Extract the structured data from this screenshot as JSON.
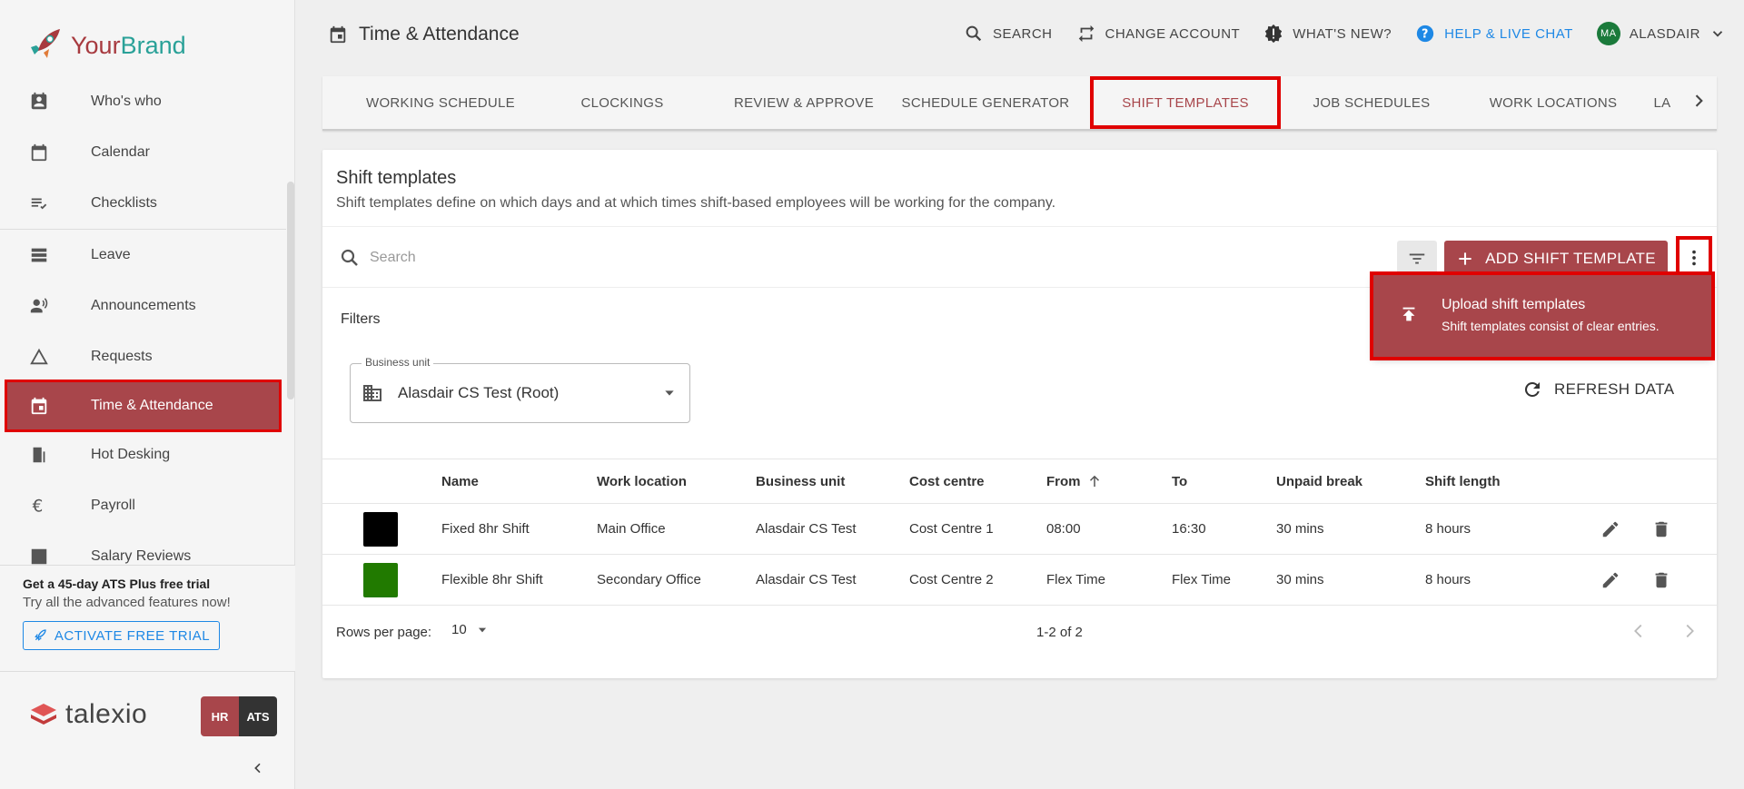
{
  "brand": {
    "part1": "Your",
    "part2": "Brand"
  },
  "sidebar": {
    "items": [
      {
        "label": "Who's who"
      },
      {
        "label": "Calendar"
      },
      {
        "label": "Checklists"
      },
      {
        "label": "Leave"
      },
      {
        "label": "Announcements"
      },
      {
        "label": "Requests"
      },
      {
        "label": "Time & Attendance"
      },
      {
        "label": "Hot Desking"
      },
      {
        "label": "Payroll"
      },
      {
        "label": "Salary Reviews"
      }
    ]
  },
  "trial": {
    "title": "Get a 45-day ATS Plus free trial",
    "subtitle": "Try all the advanced features now!",
    "button": "ACTIVATE FREE TRIAL"
  },
  "footer_brand": {
    "name": "talexio",
    "hr": "HR",
    "ats": "ATS"
  },
  "header": {
    "title": "Time & Attendance",
    "search": "SEARCH",
    "change_account": "CHANGE ACCOUNT",
    "whats_new": "WHAT'S NEW?",
    "help": "HELP & LIVE CHAT",
    "avatar_initials": "MA",
    "user": "ALASDAIR"
  },
  "tabs": [
    {
      "label": "WORKING SCHEDULE"
    },
    {
      "label": "CLOCKINGS"
    },
    {
      "label": "REVIEW & APPROVE"
    },
    {
      "label": "SCHEDULE GENERATOR"
    },
    {
      "label": "SHIFT TEMPLATES",
      "active": true
    },
    {
      "label": "JOB SCHEDULES"
    },
    {
      "label": "WORK LOCATIONS"
    },
    {
      "label": "LA"
    }
  ],
  "card": {
    "title": "Shift templates",
    "description": "Shift templates define on which days and at which times shift-based employees will be working for the company.",
    "search_placeholder": "Search",
    "add_button": "ADD SHIFT TEMPLATE",
    "filters_label": "Filters",
    "business_unit_label": "Business unit",
    "business_unit_value": "Alasdair CS Test (Root)",
    "refresh": "REFRESH DATA"
  },
  "menu": {
    "title": "Upload shift templates",
    "subtitle": "Shift templates consist of clear entries."
  },
  "table": {
    "columns": [
      "Name",
      "Work location",
      "Business unit",
      "Cost centre",
      "From",
      "To",
      "Unpaid break",
      "Shift length"
    ],
    "rows": [
      {
        "color": "#000000",
        "name": "Fixed 8hr Shift",
        "location": "Main Office",
        "unit": "Alasdair CS Test",
        "cost": "Cost Centre 1",
        "from": "08:00",
        "to": "16:30",
        "break": "30 mins",
        "length": "8 hours"
      },
      {
        "color": "#217a00",
        "name": "Flexible 8hr Shift",
        "location": "Secondary Office",
        "unit": "Alasdair CS Test",
        "cost": "Cost Centre 2",
        "from": "Flex Time",
        "to": "Flex Time",
        "break": "30 mins",
        "length": "8 hours"
      }
    ]
  },
  "pagination": {
    "rows_per_page_label": "Rows per page:",
    "rows_per_page": "10",
    "range": "1-2 of 2"
  },
  "colors": {
    "accent": "#a8464b",
    "highlight": "#e00000",
    "link": "#1e88e5"
  }
}
